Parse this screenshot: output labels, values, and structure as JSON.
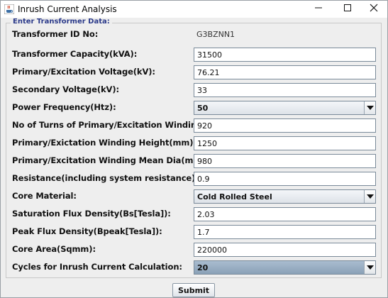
{
  "window": {
    "title": "Inrush Current Analysis",
    "icons": {
      "app": "java-cup-icon",
      "minimize": "minimize-icon",
      "maximize": "maximize-icon",
      "close": "close-icon"
    }
  },
  "form": {
    "group_title": "Enter Transformer Data:",
    "fields": [
      {
        "label": "Transformer ID No:",
        "value": "G3BZNN1",
        "kind": "static"
      },
      {
        "label": "Transformer Capacity(kVA):",
        "value": "31500",
        "kind": "text"
      },
      {
        "label": "Primary/Excitation Voltage(kV):",
        "value": "76.21",
        "kind": "text"
      },
      {
        "label": "Secondary Voltage(kV):",
        "value": "33",
        "kind": "text"
      },
      {
        "label": "Power Frequency(Htz):",
        "value": "50",
        "kind": "select"
      },
      {
        "label": "No of Turns of Primary/Excitation Winding(N):",
        "value": "920",
        "kind": "text"
      },
      {
        "label": "Primary/Exictation Winding Height(mm):",
        "value": "1250",
        "kind": "text"
      },
      {
        "label": "Primary/Excitation Winding Mean Dia(mm):",
        "value": "980",
        "kind": "text"
      },
      {
        "label": "Resistance(including system resistance):",
        "value": "0.9",
        "kind": "text"
      },
      {
        "label": "Core Material:",
        "value": "Cold Rolled Steel",
        "kind": "select"
      },
      {
        "label": "Saturation Flux Density(Bs[Tesla]):",
        "value": "2.03",
        "kind": "text"
      },
      {
        "label": "Peak Flux Density(Bpeak[Tesla]):",
        "value": "1.7",
        "kind": "text"
      },
      {
        "label": "Core Area(Sqmm):",
        "value": "220000",
        "kind": "text"
      },
      {
        "label": "Cycles for Inrush Current Calculation:",
        "value": "20",
        "kind": "select-focused"
      }
    ],
    "submit_label": "Submit"
  },
  "colors": {
    "legend": "#2b3a8a",
    "focused_combo": "#8aa1b7",
    "background": "#eeeeee"
  }
}
